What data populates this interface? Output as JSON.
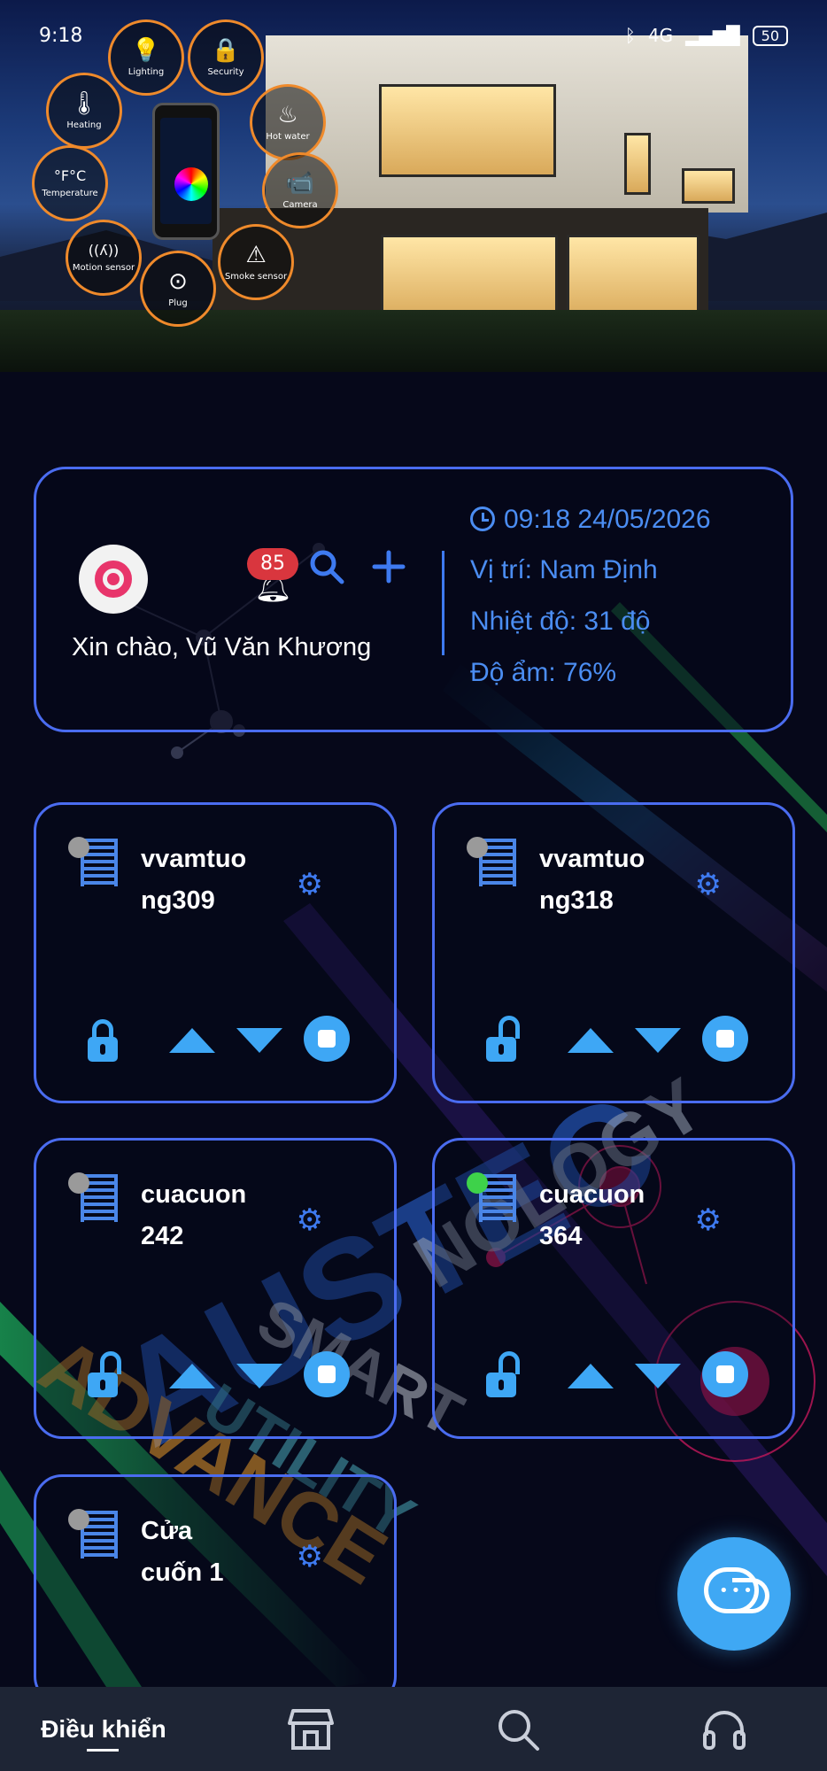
{
  "statusbar": {
    "time": "9:18",
    "battery": "50",
    "network": "4G"
  },
  "hero": {
    "features": [
      {
        "icon": "lightbulb-icon",
        "glyph": "💡",
        "label": "Lighting"
      },
      {
        "icon": "lock-icon",
        "glyph": "🔒",
        "label": "Security"
      },
      {
        "icon": "hot-water-icon",
        "glyph": "♨",
        "label": "Hot water"
      },
      {
        "icon": "camera-icon",
        "glyph": "📹",
        "label": "Camera"
      },
      {
        "icon": "smoke-sensor-icon",
        "glyph": "⚠",
        "label": "Smoke sensor"
      },
      {
        "icon": "plug-icon",
        "glyph": "⊙",
        "label": "Plug"
      },
      {
        "icon": "motion-sensor-icon",
        "glyph": "((ʎ))",
        "label": "Motion sensor"
      },
      {
        "icon": "temperature-icon",
        "glyph": "°F°C",
        "label": "Temperature"
      },
      {
        "icon": "thermometer-icon",
        "glyph": "🌡",
        "label": "Heating"
      }
    ]
  },
  "info": {
    "greeting": "Xin chào, Vũ Văn Khương",
    "notification_count": "85",
    "datetime": "09:18 24/05/2026",
    "location": "Vị trí: Nam Định",
    "temperature": "Nhiệt độ: 31 độ",
    "humidity": "Độ ẩm: 76%",
    "icons": {
      "bell": "bell-icon",
      "search": "search-icon",
      "add": "plus-icon",
      "clock": "clock-icon"
    },
    "accent": "#4b8df2"
  },
  "devices": [
    {
      "line1": "vvamtuo",
      "line2": "ng309",
      "online": false,
      "locked": true
    },
    {
      "line1": "vvamtuo",
      "line2": "ng318",
      "online": false,
      "locked": false
    },
    {
      "line1": "cuacuon",
      "line2": "242",
      "online": false,
      "locked": false
    },
    {
      "line1": "cuacuon",
      "line2": "364",
      "online": true,
      "locked": false
    },
    {
      "line1": "Cửa",
      "line2": "cuốn 1",
      "online": false,
      "locked": false
    }
  ],
  "watermark": {
    "lines": [
      "AUSTEC",
      "NOLOGY",
      "SMART",
      "UTILITY",
      "ADVANCE"
    ]
  },
  "nav": {
    "active_label": "Điều khiển",
    "items": [
      "control",
      "store-icon",
      "search-icon",
      "headset-icon"
    ]
  },
  "colors": {
    "card_border": "#4a6cf0",
    "control_blue": "#3ea7f5",
    "badge_red": "#d9363e",
    "online_green": "#3ed24a"
  }
}
